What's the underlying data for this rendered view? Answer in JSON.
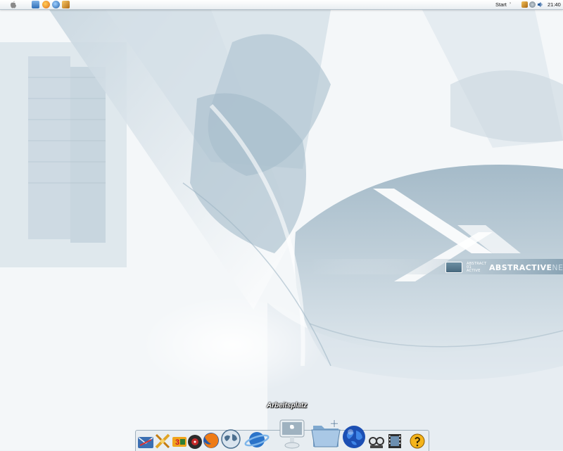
{
  "menubar": {
    "start_label": "Start",
    "start_arrow": "›",
    "clock": "21:40",
    "quicklaunch": [
      "apple-logo-icon",
      "finder-icon",
      "firefox-icon",
      "browser-globe-icon",
      "tools-icon"
    ],
    "tray": [
      "network-icon",
      "settings-icon",
      "volume-icon"
    ]
  },
  "wallpaper": {
    "brand_small_line1": "ABSTRACT",
    "brand_small_line2": "01 ACTIVE",
    "brand_bold": "ABSTRACTIVE",
    "brand_light": "NET"
  },
  "dock": {
    "hover_label": "Arbeitsplatz",
    "items": [
      "mail-icon",
      "tools-icon",
      "games-icon",
      "music-icon",
      "firefox-icon",
      "world-globe-icon",
      "planet-icon",
      "imac-computer-icon",
      "folder-icon",
      "earth-globe-icon",
      "media-player-icon",
      "film-icon",
      "help-icon"
    ]
  },
  "colors": {
    "wallpaper_base": "#eef3f6",
    "wallpaper_accent": "#6f8fa3"
  }
}
